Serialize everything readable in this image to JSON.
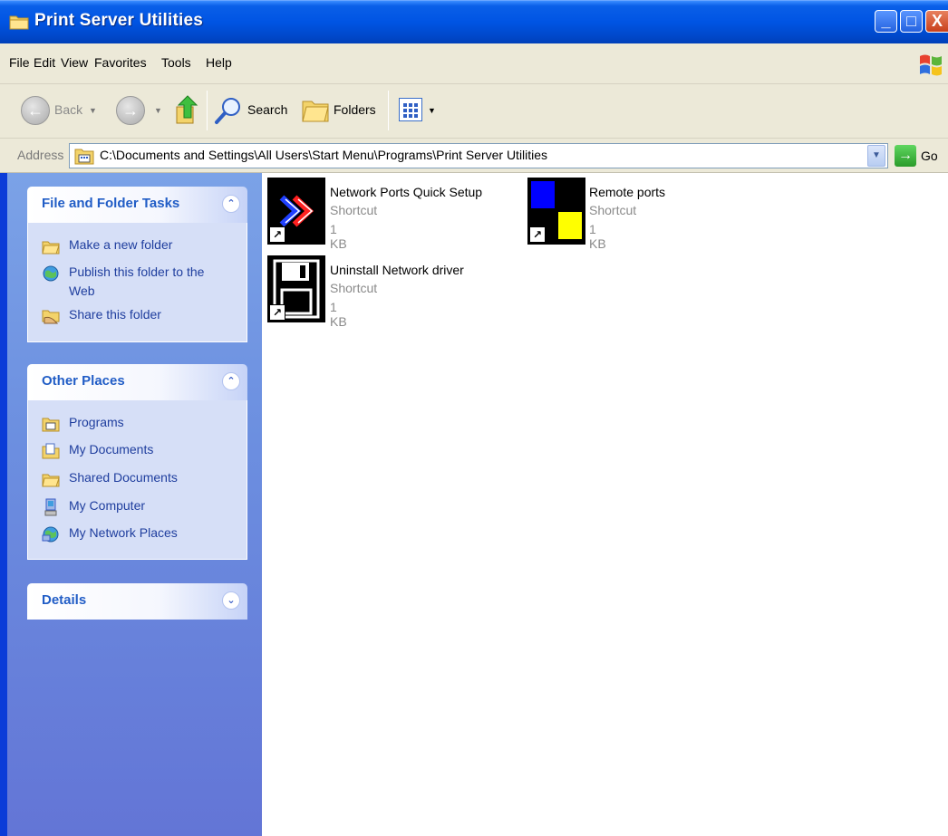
{
  "window": {
    "title": "Print Server Utilities",
    "buttons": {
      "minimize": "_",
      "maximize": "□",
      "close": "X"
    }
  },
  "menu": {
    "items": [
      {
        "label": "File"
      },
      {
        "label": "Edit"
      },
      {
        "label": "View"
      },
      {
        "label": "Favorites"
      },
      {
        "label": "Tools"
      },
      {
        "label": "Help"
      }
    ]
  },
  "toolbar": {
    "back_label": "Back",
    "search_label": "Search",
    "folders_label": "Folders"
  },
  "address": {
    "label": "Address",
    "path": "C:\\Documents and Settings\\All Users\\Start Menu\\Programs\\Print Server Utilities",
    "go_label": "Go"
  },
  "taskpane": {
    "file_tasks": {
      "title": "File and Folder Tasks",
      "links": [
        {
          "label": "Make a new folder",
          "icon": "new-folder-icon"
        },
        {
          "label": "Publish this folder to the",
          "label2": "Web",
          "icon": "publish-web-icon"
        },
        {
          "label": "Share this folder",
          "icon": "share-folder-icon"
        }
      ]
    },
    "other_places": {
      "title": "Other Places",
      "links": [
        {
          "label": "Programs",
          "icon": "programs-folder-icon"
        },
        {
          "label": "My Documents",
          "icon": "my-documents-icon"
        },
        {
          "label": "Shared Documents",
          "icon": "shared-documents-icon"
        },
        {
          "label": "My Computer",
          "icon": "my-computer-icon"
        },
        {
          "label": "My Network Places",
          "icon": "my-network-places-icon"
        }
      ]
    },
    "details": {
      "title": "Details"
    }
  },
  "files": [
    {
      "name": "Network Ports Quick Setup",
      "type": "Shortcut",
      "size": "1 KB",
      "icon": "network-ports-shortcut-icon"
    },
    {
      "name": "Remote ports",
      "type": "Shortcut",
      "size": "1 KB",
      "icon": "remote-ports-shortcut-icon"
    },
    {
      "name": "Uninstall Network driver",
      "type": "Shortcut",
      "size": "1 KB",
      "icon": "uninstall-driver-shortcut-icon"
    }
  ],
  "colors": {
    "titlebar": "#0054e3",
    "menu_bg": "#ece9d8",
    "taskpane_link": "#1f3e9e",
    "panel_title": "#215dc6"
  }
}
